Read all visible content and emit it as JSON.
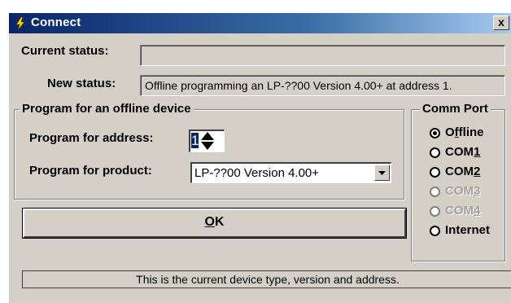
{
  "window": {
    "title": "Connect",
    "close_label": "x",
    "accent_color": "#0a246a"
  },
  "status": {
    "current_label": "Current status:",
    "current_value": "",
    "new_label": "New status:",
    "new_value": "Offline programming an LP-??00 Version 4.00+ at address 1."
  },
  "offline_group": {
    "title": "Program for an offline device",
    "address_label": "Program for address:",
    "address_value": "1",
    "product_label": "Program for product:",
    "product_value": "LP-??00 Version 4.00+"
  },
  "ok_button": {
    "prefix": "",
    "mnemonic": "O",
    "suffix": "K"
  },
  "comm_port": {
    "title": "Comm Port",
    "options": [
      {
        "pre": "O",
        "mn": "f",
        "post": "fline",
        "selected": true,
        "enabled": true
      },
      {
        "pre": "COM",
        "mn": "1",
        "post": "",
        "selected": false,
        "enabled": true
      },
      {
        "pre": "COM",
        "mn": "2",
        "post": "",
        "selected": false,
        "enabled": true
      },
      {
        "pre": "COM",
        "mn": "3",
        "post": "",
        "selected": false,
        "enabled": false
      },
      {
        "pre": "COM",
        "mn": "4",
        "post": "",
        "selected": false,
        "enabled": false
      },
      {
        "pre": "Internet",
        "mn": "",
        "post": "",
        "selected": false,
        "enabled": true
      }
    ]
  },
  "status_bar": {
    "text": "This is the current device type, version and address."
  },
  "icons": {
    "title": "lightbulb-icon",
    "spin": "spin-arrows-icon",
    "dropdown": "chevron-down-icon"
  }
}
